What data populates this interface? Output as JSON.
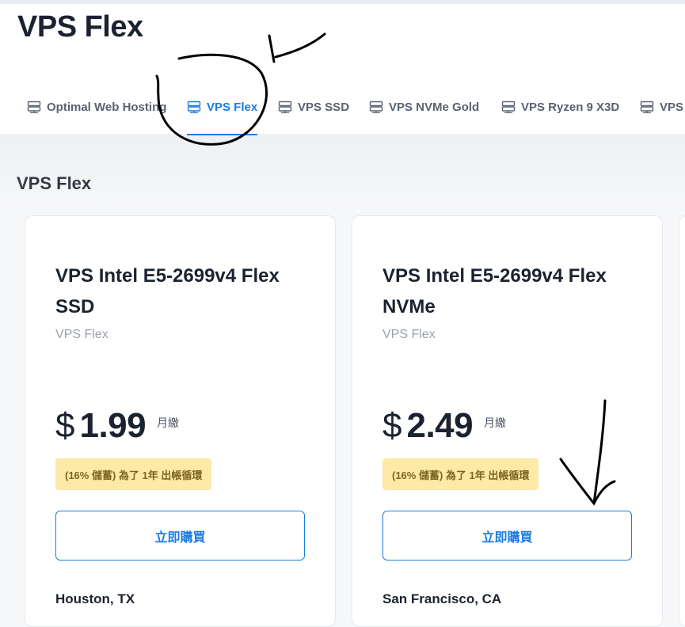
{
  "header": {
    "title": "VPS Flex"
  },
  "tabs": [
    {
      "label": "Optimal Web Hosting",
      "icon": "server-icon",
      "active": false
    },
    {
      "label": "VPS Flex",
      "icon": "server-icon",
      "active": true
    },
    {
      "label": "VPS SSD",
      "icon": "server-icon",
      "active": false
    },
    {
      "label": "VPS NVMe Gold",
      "icon": "server-icon",
      "active": false
    },
    {
      "label": "VPS Ryzen 9 X3D",
      "icon": "server-icon",
      "active": false
    },
    {
      "label": "VPS",
      "icon": "server-icon",
      "active": false
    }
  ],
  "section": {
    "title": "VPS Flex"
  },
  "products": [
    {
      "name": "VPS Intel E5-2699v4 Flex SSD",
      "category": "VPS Flex",
      "currency": "$",
      "price": "1.99",
      "period": "月繳",
      "badge": "(16% 儲蓄) 為了 1年 出帳循環",
      "button": "立即購買",
      "location": "Houston, TX"
    },
    {
      "name": "VPS Intel E5-2699v4 Flex NVMe",
      "category": "VPS Flex",
      "currency": "$",
      "price": "2.49",
      "period": "月繳",
      "badge": "(16% 儲蓄) 為了 1年 出帳循環",
      "button": "立即購買",
      "location": "San Francisco, CA"
    }
  ],
  "colors": {
    "accent": "#1c7ce0",
    "badge_bg": "#fde9a8",
    "text": "#1b2230"
  }
}
